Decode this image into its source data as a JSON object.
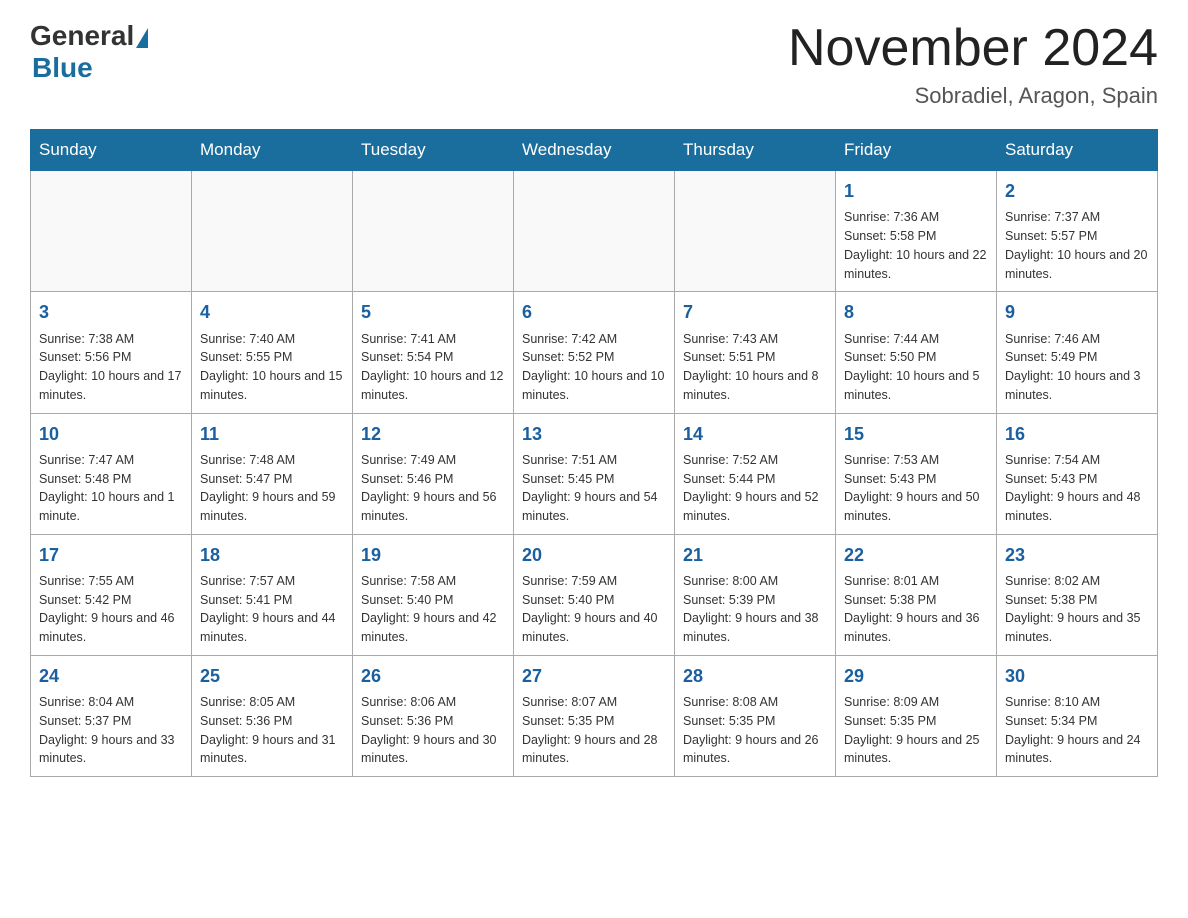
{
  "header": {
    "logo_general": "General",
    "logo_blue": "Blue",
    "month_title": "November 2024",
    "location": "Sobradiel, Aragon, Spain"
  },
  "weekdays": [
    "Sunday",
    "Monday",
    "Tuesday",
    "Wednesday",
    "Thursday",
    "Friday",
    "Saturday"
  ],
  "weeks": [
    [
      {
        "day": "",
        "info": ""
      },
      {
        "day": "",
        "info": ""
      },
      {
        "day": "",
        "info": ""
      },
      {
        "day": "",
        "info": ""
      },
      {
        "day": "",
        "info": ""
      },
      {
        "day": "1",
        "info": "Sunrise: 7:36 AM\nSunset: 5:58 PM\nDaylight: 10 hours and 22 minutes."
      },
      {
        "day": "2",
        "info": "Sunrise: 7:37 AM\nSunset: 5:57 PM\nDaylight: 10 hours and 20 minutes."
      }
    ],
    [
      {
        "day": "3",
        "info": "Sunrise: 7:38 AM\nSunset: 5:56 PM\nDaylight: 10 hours and 17 minutes."
      },
      {
        "day": "4",
        "info": "Sunrise: 7:40 AM\nSunset: 5:55 PM\nDaylight: 10 hours and 15 minutes."
      },
      {
        "day": "5",
        "info": "Sunrise: 7:41 AM\nSunset: 5:54 PM\nDaylight: 10 hours and 12 minutes."
      },
      {
        "day": "6",
        "info": "Sunrise: 7:42 AM\nSunset: 5:52 PM\nDaylight: 10 hours and 10 minutes."
      },
      {
        "day": "7",
        "info": "Sunrise: 7:43 AM\nSunset: 5:51 PM\nDaylight: 10 hours and 8 minutes."
      },
      {
        "day": "8",
        "info": "Sunrise: 7:44 AM\nSunset: 5:50 PM\nDaylight: 10 hours and 5 minutes."
      },
      {
        "day": "9",
        "info": "Sunrise: 7:46 AM\nSunset: 5:49 PM\nDaylight: 10 hours and 3 minutes."
      }
    ],
    [
      {
        "day": "10",
        "info": "Sunrise: 7:47 AM\nSunset: 5:48 PM\nDaylight: 10 hours and 1 minute."
      },
      {
        "day": "11",
        "info": "Sunrise: 7:48 AM\nSunset: 5:47 PM\nDaylight: 9 hours and 59 minutes."
      },
      {
        "day": "12",
        "info": "Sunrise: 7:49 AM\nSunset: 5:46 PM\nDaylight: 9 hours and 56 minutes."
      },
      {
        "day": "13",
        "info": "Sunrise: 7:51 AM\nSunset: 5:45 PM\nDaylight: 9 hours and 54 minutes."
      },
      {
        "day": "14",
        "info": "Sunrise: 7:52 AM\nSunset: 5:44 PM\nDaylight: 9 hours and 52 minutes."
      },
      {
        "day": "15",
        "info": "Sunrise: 7:53 AM\nSunset: 5:43 PM\nDaylight: 9 hours and 50 minutes."
      },
      {
        "day": "16",
        "info": "Sunrise: 7:54 AM\nSunset: 5:43 PM\nDaylight: 9 hours and 48 minutes."
      }
    ],
    [
      {
        "day": "17",
        "info": "Sunrise: 7:55 AM\nSunset: 5:42 PM\nDaylight: 9 hours and 46 minutes."
      },
      {
        "day": "18",
        "info": "Sunrise: 7:57 AM\nSunset: 5:41 PM\nDaylight: 9 hours and 44 minutes."
      },
      {
        "day": "19",
        "info": "Sunrise: 7:58 AM\nSunset: 5:40 PM\nDaylight: 9 hours and 42 minutes."
      },
      {
        "day": "20",
        "info": "Sunrise: 7:59 AM\nSunset: 5:40 PM\nDaylight: 9 hours and 40 minutes."
      },
      {
        "day": "21",
        "info": "Sunrise: 8:00 AM\nSunset: 5:39 PM\nDaylight: 9 hours and 38 minutes."
      },
      {
        "day": "22",
        "info": "Sunrise: 8:01 AM\nSunset: 5:38 PM\nDaylight: 9 hours and 36 minutes."
      },
      {
        "day": "23",
        "info": "Sunrise: 8:02 AM\nSunset: 5:38 PM\nDaylight: 9 hours and 35 minutes."
      }
    ],
    [
      {
        "day": "24",
        "info": "Sunrise: 8:04 AM\nSunset: 5:37 PM\nDaylight: 9 hours and 33 minutes."
      },
      {
        "day": "25",
        "info": "Sunrise: 8:05 AM\nSunset: 5:36 PM\nDaylight: 9 hours and 31 minutes."
      },
      {
        "day": "26",
        "info": "Sunrise: 8:06 AM\nSunset: 5:36 PM\nDaylight: 9 hours and 30 minutes."
      },
      {
        "day": "27",
        "info": "Sunrise: 8:07 AM\nSunset: 5:35 PM\nDaylight: 9 hours and 28 minutes."
      },
      {
        "day": "28",
        "info": "Sunrise: 8:08 AM\nSunset: 5:35 PM\nDaylight: 9 hours and 26 minutes."
      },
      {
        "day": "29",
        "info": "Sunrise: 8:09 AM\nSunset: 5:35 PM\nDaylight: 9 hours and 25 minutes."
      },
      {
        "day": "30",
        "info": "Sunrise: 8:10 AM\nSunset: 5:34 PM\nDaylight: 9 hours and 24 minutes."
      }
    ]
  ]
}
